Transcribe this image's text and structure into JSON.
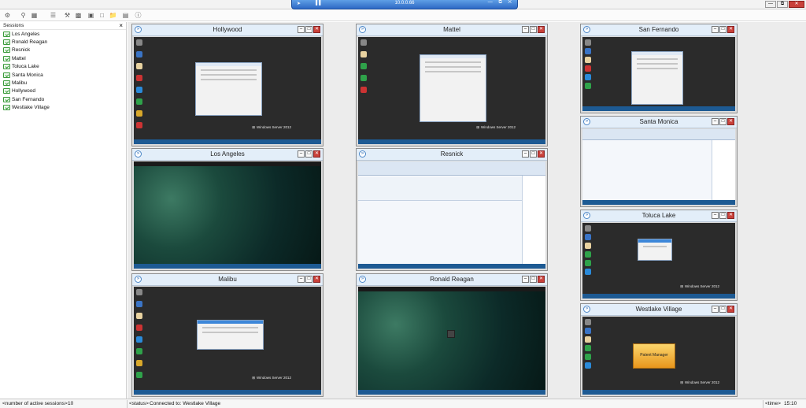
{
  "rdbar": {
    "address": "10.0.0.66",
    "pin": "➤",
    "signal": "▌▌",
    "controls": "— ⧉ ✕"
  },
  "toolbar_icons": [
    "gear-plus-icon",
    "find-icon",
    "screen-icon",
    "list-icon",
    "tools-icon",
    "chart-icon",
    "fullscreen-icon",
    "window-icon",
    "folder-icon",
    "image-icon",
    "info-icon"
  ],
  "sessions_panel": {
    "header": "Sessions",
    "close": "×",
    "items": [
      "Los Angeles",
      "Ronald Reagan",
      "Resnick",
      "Mattel",
      "Toluca Lake",
      "Santa Monica",
      "Malibu",
      "Hollywood",
      "San Fernando",
      "Westlake Village"
    ]
  },
  "sessions": {
    "hollywood": "Hollywood",
    "los_angeles": "Los Angeles",
    "malibu": "Malibu",
    "mattel": "Mattel",
    "resnick": "Resnick",
    "ronald_reagan": "Ronald Reagan",
    "san_fernando": "San Fernando",
    "santa_monica": "Santa Monica",
    "toluca_lake": "Toluca Lake",
    "westlake_village": "Westlake Village"
  },
  "windows_server_label": "Windows Server 2012",
  "westlake_dialog": "Patent Manager",
  "title_controls": {
    "min": "‒",
    "max": "□",
    "close": "✕",
    "chev": "»"
  },
  "statusbar": {
    "sessions_label": "<number of active sessions>",
    "sessions_count": "10",
    "status_label": "<status>",
    "status_value": "Connected to: Westlake Village",
    "time_label": "<time>",
    "time_value": "15:10"
  },
  "colors": {
    "accent": "#2e69c4",
    "session_ok": "#3a9b3a",
    "close_red": "#c9413a"
  }
}
